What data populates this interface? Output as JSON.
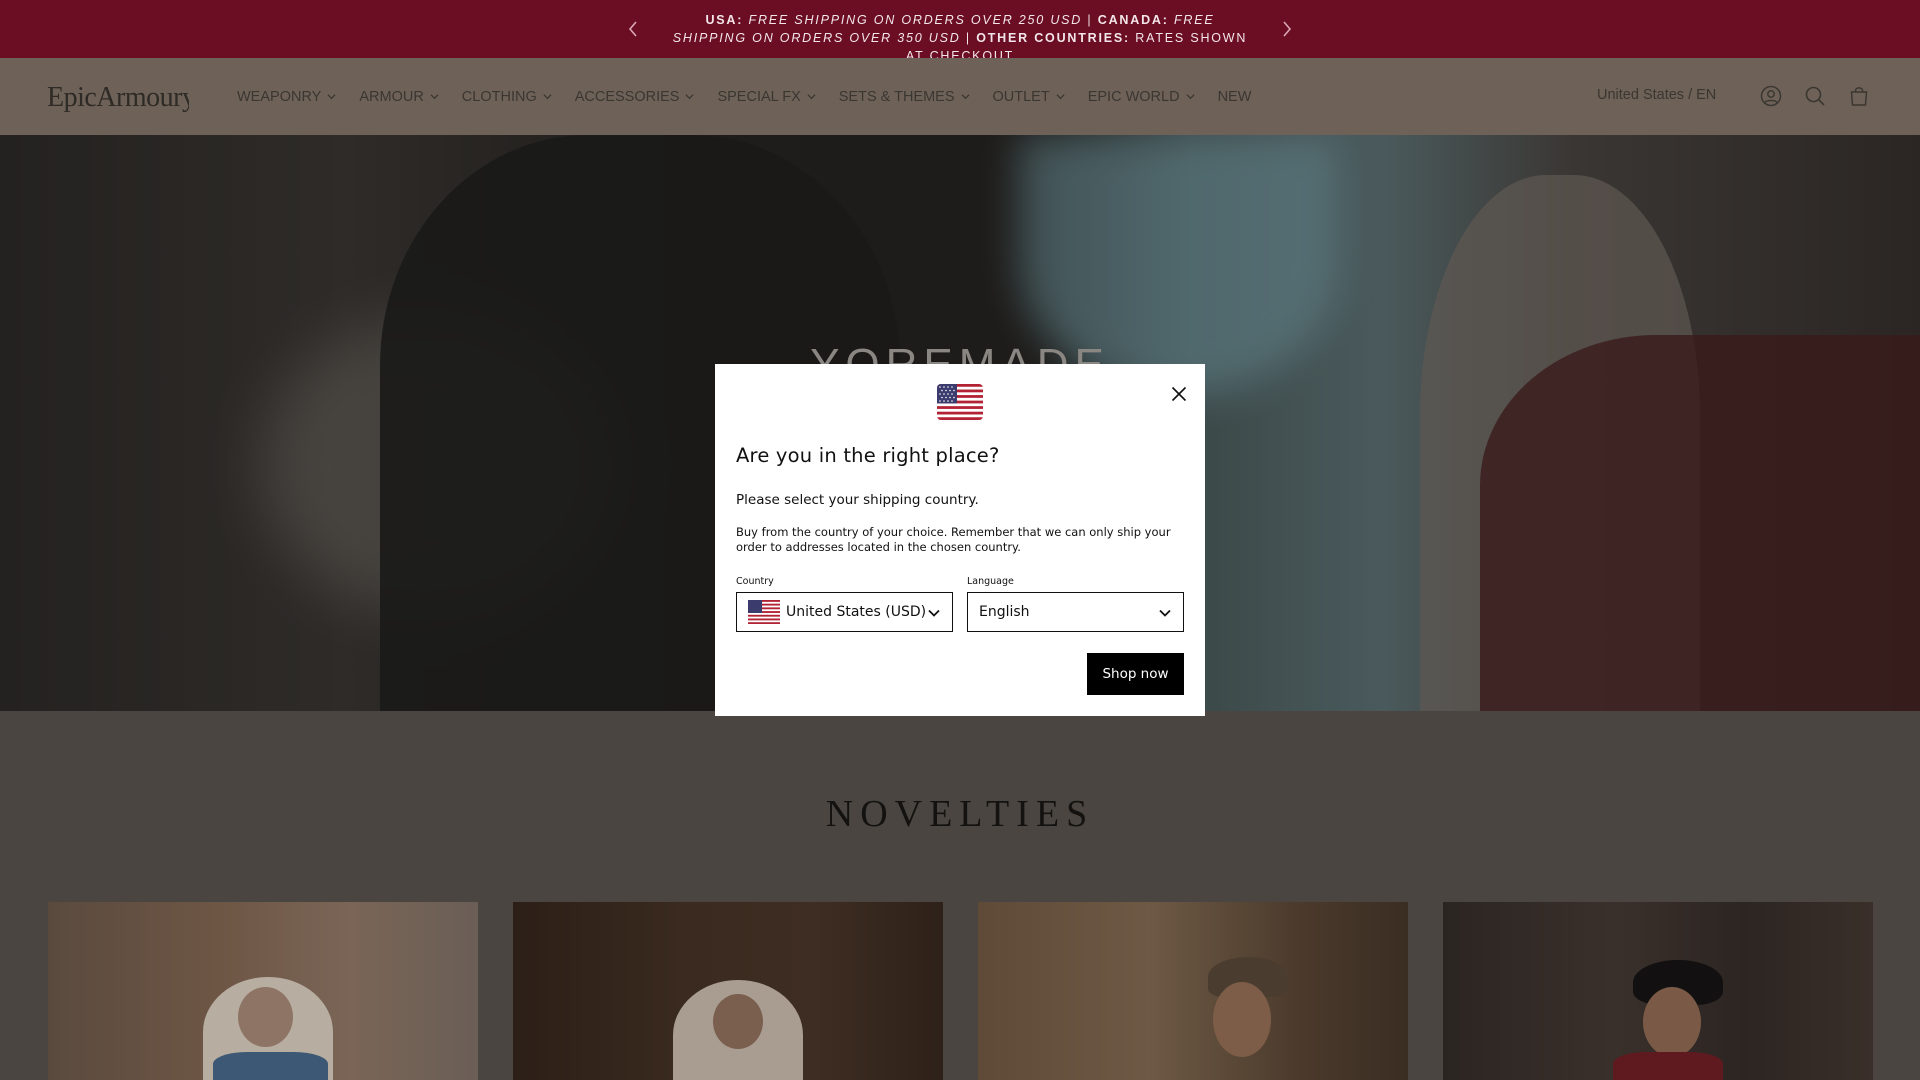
{
  "announcement": {
    "usa_label": "USA:",
    "usa_text": "FREE SHIPPING ON ORDERS OVER 250 USD",
    "sep1": "|",
    "canada_label": "CANADA:",
    "canada_text": "FREE SHIPPING ON ORDERS OVER 350 USD",
    "sep2": "|",
    "other_label": "OTHER COUNTRIES:",
    "other_text": "RATES SHOWN AT CHECKOUT",
    "prev_icon": "chevron-left-icon",
    "next_icon": "chevron-right-icon",
    "bg_color": "#6b0e24"
  },
  "header": {
    "logo_text": "EpicArmoury",
    "nav": [
      {
        "label": "WEAPONRY",
        "has_dropdown": true
      },
      {
        "label": "ARMOUR",
        "has_dropdown": true
      },
      {
        "label": "CLOTHING",
        "has_dropdown": true
      },
      {
        "label": "ACCESSORIES",
        "has_dropdown": true
      },
      {
        "label": "SPECIAL FX",
        "has_dropdown": true
      },
      {
        "label": "SETS & THEMES",
        "has_dropdown": true
      },
      {
        "label": "OUTLET",
        "has_dropdown": true
      },
      {
        "label": "EPIC WORLD",
        "has_dropdown": true
      },
      {
        "label": "NEW",
        "has_dropdown": false
      }
    ],
    "locale": "United States / EN",
    "icons": [
      "account-icon",
      "search-icon",
      "cart-icon"
    ]
  },
  "hero": {
    "title": "YOREMADE"
  },
  "novelties": {
    "title": "NOVELTIES"
  },
  "modal": {
    "flag_icon": "us-flag-icon",
    "close_icon": "close-icon",
    "title": "Are you in the right place?",
    "subtitle": "Please select your shipping country.",
    "description": "Buy from the country of your choice. Remember that we can only ship your order to addresses located in the chosen country.",
    "country_label": "Country",
    "country_value": "United States (USD)",
    "language_label": "Language",
    "language_value": "English",
    "button_label": "Shop now"
  }
}
